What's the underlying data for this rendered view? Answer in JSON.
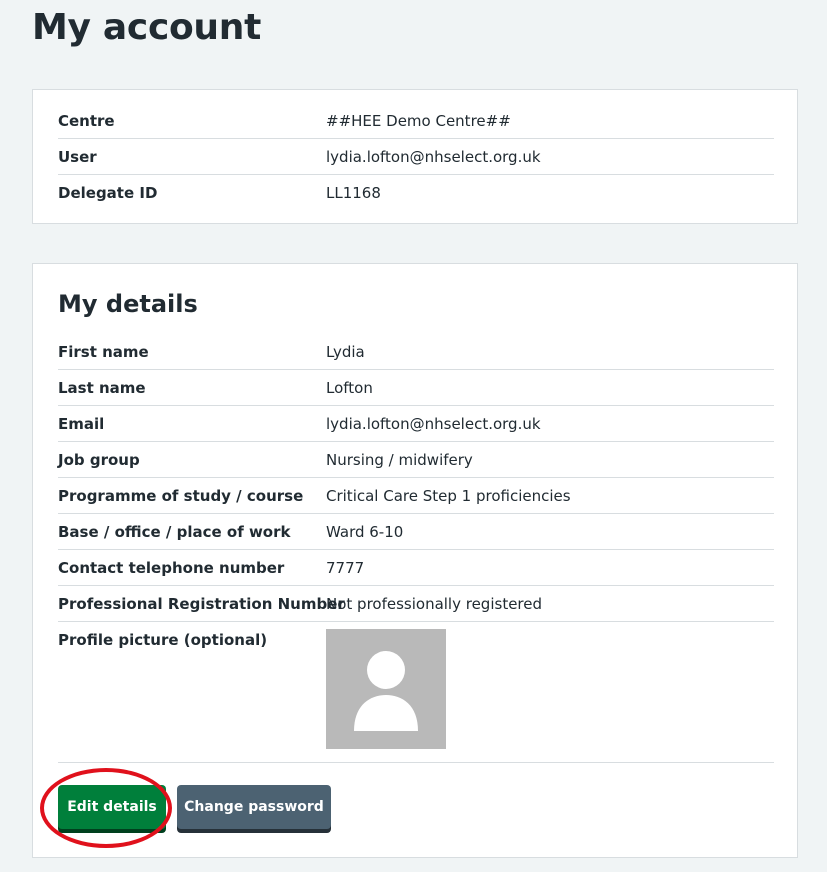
{
  "page": {
    "title": "My account"
  },
  "account": {
    "rows": [
      {
        "key": "Centre",
        "value": "##HEE Demo Centre##"
      },
      {
        "key": "User",
        "value": "lydia.lofton@nhselect.org.uk"
      },
      {
        "key": "Delegate ID",
        "value": "LL1168"
      }
    ]
  },
  "details": {
    "title": "My details",
    "rows": [
      {
        "key": "First name",
        "value": "Lydia"
      },
      {
        "key": "Last name",
        "value": "Lofton"
      },
      {
        "key": "Email",
        "value": "lydia.lofton@nhselect.org.uk"
      },
      {
        "key": "Job group",
        "value": "Nursing / midwifery"
      },
      {
        "key": "Programme of study / course",
        "value": "Critical Care Step 1 proficiencies"
      },
      {
        "key": "Base / office / place of work",
        "value": "Ward 6-10"
      },
      {
        "key": "Contact telephone number",
        "value": "7777"
      },
      {
        "key": "Professional Registration Number",
        "value": "Not professionally registered"
      }
    ],
    "profile_picture_label": "Profile picture (optional)",
    "profile_picture_icon": "default-avatar-icon"
  },
  "actions": {
    "edit_label": "Edit details",
    "password_label": "Change password"
  },
  "colors": {
    "primary_green": "#007f3b",
    "secondary_grey": "#4c6272",
    "highlight_red": "#e0111c"
  }
}
